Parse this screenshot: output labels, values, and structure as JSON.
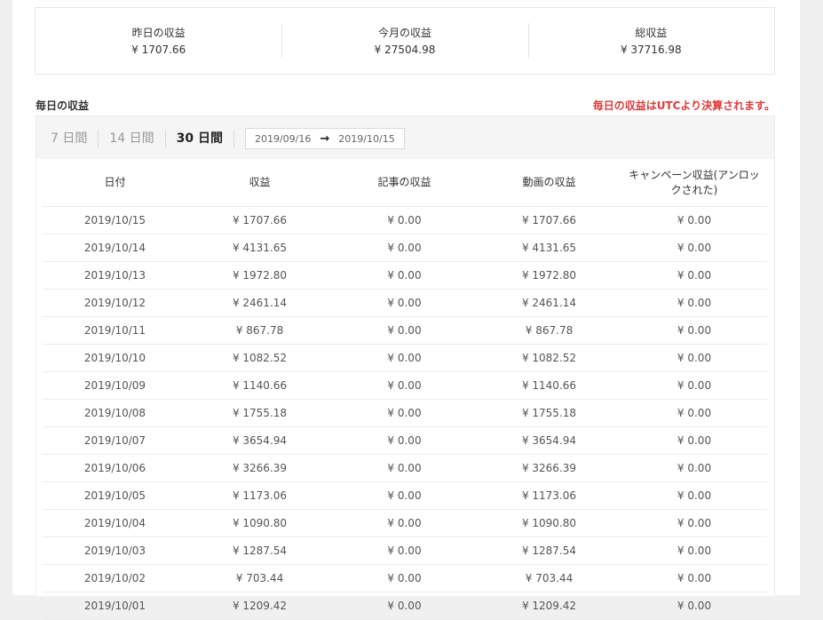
{
  "summary": {
    "yesterday_label": "昨日の収益",
    "yesterday_value": "¥ 1707.66",
    "month_label": "今月の収益",
    "month_value": "¥ 27504.98",
    "total_label": "総収益",
    "total_value": "¥ 37716.98"
  },
  "daily": {
    "title": "毎日の収益",
    "notice": "毎日の収益はUTCより決算されます。",
    "ranges": [
      "7 日間",
      "14 日間",
      "30 日間"
    ],
    "active_range": "30 日間",
    "date_from": "2019/09/16",
    "arrow": "→",
    "date_to": "2019/10/15"
  },
  "table": {
    "headers": [
      "日付",
      "収益",
      "記事の収益",
      "動画の収益",
      "キャンペーン収益(アンロックされた)"
    ],
    "rows": [
      [
        "2019/10/15",
        "¥ 1707.66",
        "¥ 0.00",
        "¥ 1707.66",
        "¥ 0.00"
      ],
      [
        "2019/10/14",
        "¥ 4131.65",
        "¥ 0.00",
        "¥ 4131.65",
        "¥ 0.00"
      ],
      [
        "2019/10/13",
        "¥ 1972.80",
        "¥ 0.00",
        "¥ 1972.80",
        "¥ 0.00"
      ],
      [
        "2019/10/12",
        "¥ 2461.14",
        "¥ 0.00",
        "¥ 2461.14",
        "¥ 0.00"
      ],
      [
        "2019/10/11",
        "¥ 867.78",
        "¥ 0.00",
        "¥ 867.78",
        "¥ 0.00"
      ],
      [
        "2019/10/10",
        "¥ 1082.52",
        "¥ 0.00",
        "¥ 1082.52",
        "¥ 0.00"
      ],
      [
        "2019/10/09",
        "¥ 1140.66",
        "¥ 0.00",
        "¥ 1140.66",
        "¥ 0.00"
      ],
      [
        "2019/10/08",
        "¥ 1755.18",
        "¥ 0.00",
        "¥ 1755.18",
        "¥ 0.00"
      ],
      [
        "2019/10/07",
        "¥ 3654.94",
        "¥ 0.00",
        "¥ 3654.94",
        "¥ 0.00"
      ],
      [
        "2019/10/06",
        "¥ 3266.39",
        "¥ 0.00",
        "¥ 3266.39",
        "¥ 0.00"
      ],
      [
        "2019/10/05",
        "¥ 1173.06",
        "¥ 0.00",
        "¥ 1173.06",
        "¥ 0.00"
      ],
      [
        "2019/10/04",
        "¥ 1090.80",
        "¥ 0.00",
        "¥ 1090.80",
        "¥ 0.00"
      ],
      [
        "2019/10/03",
        "¥ 1287.54",
        "¥ 0.00",
        "¥ 1287.54",
        "¥ 0.00"
      ],
      [
        "2019/10/02",
        "¥ 703.44",
        "¥ 0.00",
        "¥ 703.44",
        "¥ 0.00"
      ],
      [
        "2019/10/01",
        "¥ 1209.42",
        "¥ 0.00",
        "¥ 1209.42",
        "¥ 0.00"
      ]
    ]
  }
}
